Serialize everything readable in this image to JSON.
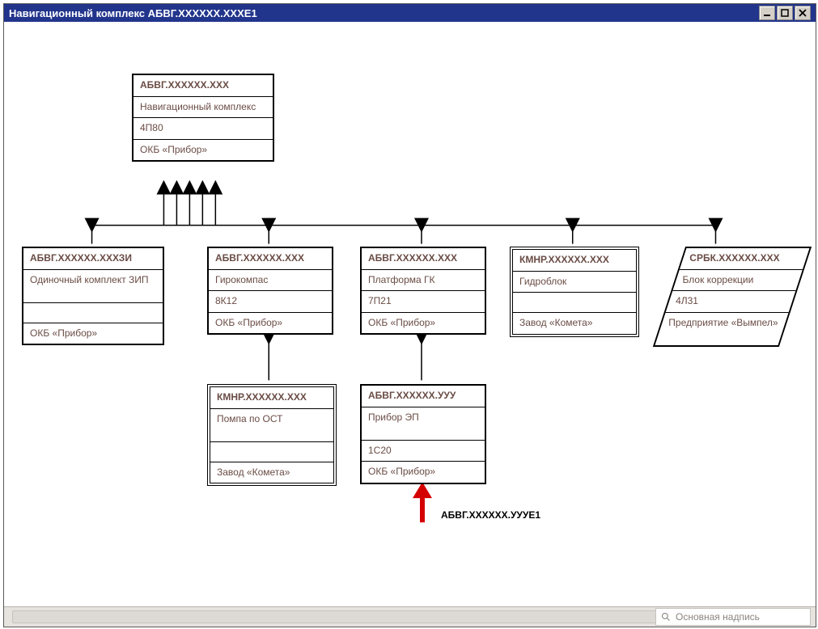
{
  "window": {
    "title": "Навигационный комплекс АБВГ.ХХХХХХ.ХХХЕ1"
  },
  "statusbar": {
    "search_placeholder": "Основная надпись"
  },
  "red_label": "АБВГ.ХХХХХХ.УУУЕ1",
  "nodes": {
    "root": {
      "code": "АБВГ.ХХХХХХ.ХХХ",
      "name": "Навигационный комплекс",
      "index": "4П80",
      "org": "ОКБ «Прибор»"
    },
    "zip": {
      "code": "АБВГ.ХХХХХХ.ХХХЗИ",
      "name": "Одиночный комплект ЗИП",
      "index": "",
      "org": "ОКБ «Прибор»"
    },
    "gyro": {
      "code": "АБВГ.ХХХХХХ.ХХХ",
      "name": "Гирокомпас",
      "index": "8К12",
      "org": "ОКБ «Прибор»"
    },
    "platform": {
      "code": "АБВГ.ХХХХХХ.ХХХ",
      "name": "Платформа ГК",
      "index": "7П21",
      "org": "ОКБ «Прибор»"
    },
    "hydro": {
      "code": "КМНР.ХХХХХХ.ХХХ",
      "name": "Гидроблок",
      "index": "",
      "org": "Завод «Комета»"
    },
    "corr": {
      "code": "СРБК.ХХХХХХ.ХХХ",
      "name": "Блок коррекции",
      "index": "4Л31",
      "org": "Предприятие «Вымпел»"
    },
    "pump": {
      "code": "КМНР.ХХХХХХ.ХХХ",
      "name": "Помпа по ОСТ",
      "index": "",
      "org": "Завод «Комета»"
    },
    "ep": {
      "code": "АБВГ.ХХХХХХ.УУУ",
      "name": "Прибор ЭП",
      "index": "1С20",
      "org": "ОКБ «Прибор»"
    }
  }
}
